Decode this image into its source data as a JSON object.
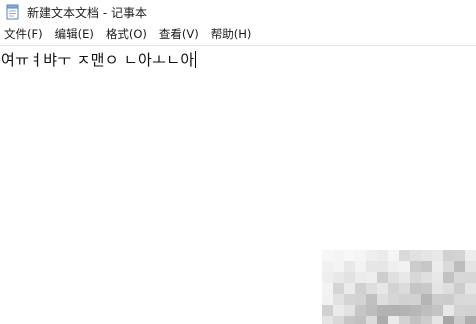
{
  "window": {
    "app_icon": "notepad-icon",
    "title": "新建文本文档 - 记事本"
  },
  "menubar": {
    "items": [
      {
        "label": "文件(F)"
      },
      {
        "label": "编辑(E)"
      },
      {
        "label": "格式(O)"
      },
      {
        "label": "查看(V)"
      },
      {
        "label": "帮助(H)"
      }
    ]
  },
  "editor": {
    "text": "여ㅠㅕ뱌ㅜ ㅈ맨ㅇ ㄴ아ㅗㄴ아"
  },
  "colors": {
    "background": "#ffffff",
    "text": "#111111",
    "menu_separator": "#e6e6e6"
  }
}
